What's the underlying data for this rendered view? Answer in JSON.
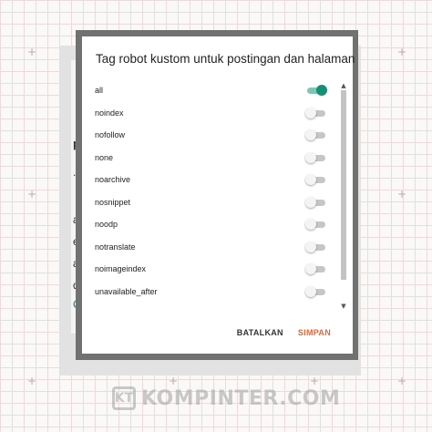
{
  "dialog": {
    "title": "Tag robot kustom untuk postingan dan halaman",
    "options": [
      {
        "label": "all",
        "enabled": true
      },
      {
        "label": "noindex",
        "enabled": false
      },
      {
        "label": "nofollow",
        "enabled": false
      },
      {
        "label": "none",
        "enabled": false
      },
      {
        "label": "noarchive",
        "enabled": false
      },
      {
        "label": "nosnippet",
        "enabled": false
      },
      {
        "label": "noodp",
        "enabled": false
      },
      {
        "label": "notranslate",
        "enabled": false
      },
      {
        "label": "noimageindex",
        "enabled": false
      },
      {
        "label": "unavailable_after",
        "enabled": false
      }
    ],
    "cancel_label": "BATALKAN",
    "save_label": "SIMPAN"
  },
  "background_page": {
    "fragments": [
      "pe",
      ".t",
      "ac",
      "er",
      "al",
      "da",
      "Co"
    ]
  },
  "watermark": {
    "logo": "KT",
    "text": "KOMPINTER.COM"
  },
  "colors": {
    "toggle_on": "#168f76",
    "toggle_track_on": "#7cc7b4",
    "save_accent": "#e0683a",
    "dialog_frame": "#717171"
  },
  "icons": {
    "scroll_up": "scroll-up-arrow-icon",
    "scroll_down": "scroll-down-arrow-icon"
  }
}
